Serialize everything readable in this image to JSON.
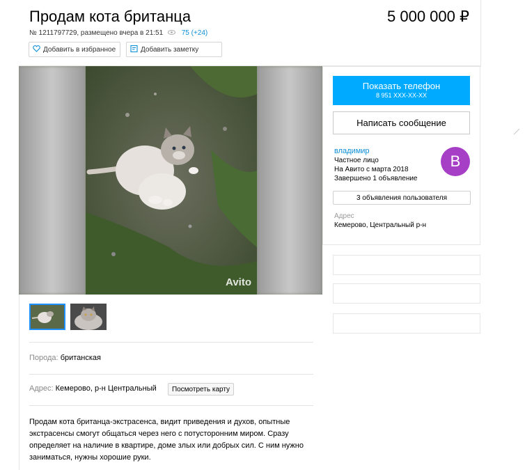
{
  "listing": {
    "title": "Продам кота британца",
    "price": "5 000 000 ₽",
    "meta_text": "№ 1211797729, размещено вчера в 21:51",
    "views": "75 (+24)",
    "favorite_label": "Добавить в избранное",
    "note_label": "Добавить заметку"
  },
  "gallery": {
    "watermark": "Avito",
    "thumbnails": [
      "photo-1",
      "photo-2"
    ]
  },
  "params": {
    "breed_label": "Порода:",
    "breed_value": "британская",
    "address_label": "Адрес:",
    "address_value": "Кемерово, р-н Центральный",
    "map_button": "Посмотреть карту"
  },
  "description": "Продам кота британца-экстрасенса, видит приведения и духов, опытные экстрасенсы смогут общаться через него с потусторонним миром. Сразу определяет на наличие в квартире, доме злых или добрых сил. С ним нужно заниматься, нужны хорошие руки.",
  "sidebar": {
    "phone_button": "Показать телефон",
    "phone_masked": "8 951 XXX-XX-XX",
    "message_button": "Написать сообщение",
    "seller_name": "владимир",
    "seller_type": "Частное лицо",
    "seller_since": "На Авито с марта 2018",
    "seller_completed": "Завершено 1 объявление",
    "avatar_letter": "В",
    "user_ads_button": "3 объявления пользователя",
    "address_label": "Адрес",
    "address_value": "Кемерово, Центральный р-н"
  },
  "colors": {
    "accent_blue": "#00aaff",
    "link_blue": "#0a8ed6",
    "avatar_purple": "#a73fc6"
  }
}
